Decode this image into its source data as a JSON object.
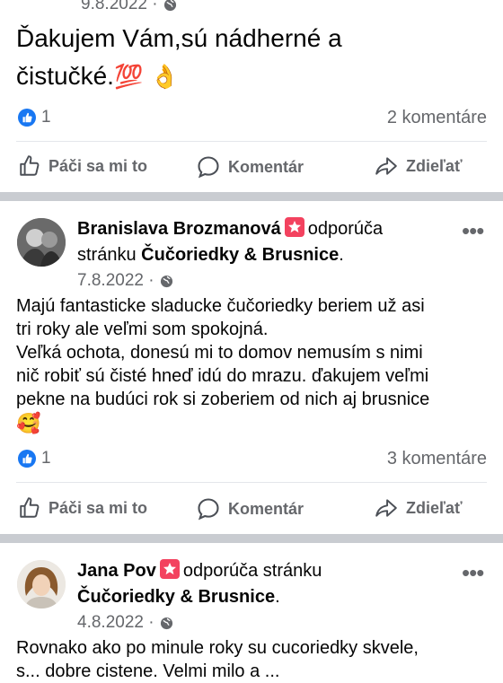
{
  "post1": {
    "date": "9.8.2022 ·",
    "text_line1": "Ďakujem Vám,sú nádherné a",
    "text_line2": "čistučké.",
    "emoji_hundred": "💯",
    "emoji_ok": "👌",
    "like_count": "1",
    "comments": "2 komentáre"
  },
  "post2": {
    "author": "Branislava Brozmanová",
    "recommends": "odporúča",
    "page_prefix": "stránku",
    "page_name": "Čučoriedky & Brusnice",
    "period": ".",
    "date": "7.8.2022 ·",
    "lines": [
      "Majú fantasticke sladucke čučoriedky beriem už asi",
      "tri roky ale veľmi som spokojná.",
      "Veľká ochota, donesú mi to domov nemusím s nimi",
      "nič robiť sú čisté hneď idú do mrazu. ďakujem veľmi",
      "pekne na budúci rok si zoberiem od nich aj brusnice"
    ],
    "emoji": "🥰",
    "like_count": "1",
    "comments": "3 komentáre",
    "more": "•••"
  },
  "post3": {
    "author": "Jana Pov",
    "recommends": "odporúča stránku",
    "page_name": "Čučoriedky & Brusnice",
    "period": ".",
    "date": "4.8.2022 ·",
    "line1": "Rovnako ako po minule roky su cucoriedky skvele,",
    "line2_partial": "s...         dobre  cistene.  Velmi milo a ...",
    "more": "•••"
  },
  "actions": {
    "like": "Páči sa mi to",
    "comment": "Komentár",
    "share": "Zdieľať"
  },
  "colors": {
    "accent": "#1877f2",
    "recommend_badge": "#f3425f",
    "muted_text": "#65676b",
    "separator": "#c9ccd1"
  }
}
